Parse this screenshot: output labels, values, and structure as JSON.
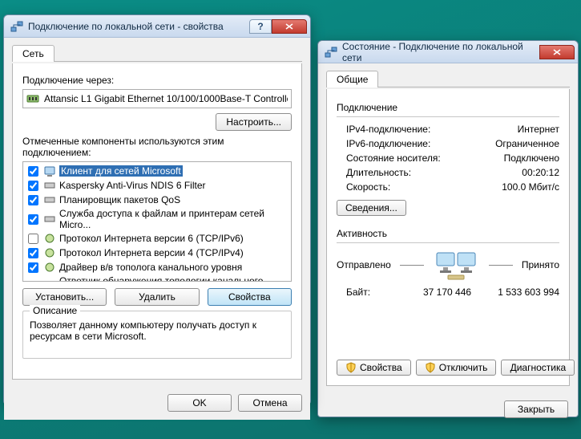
{
  "props": {
    "title": "Подключение по локальной сети - свойства",
    "tab": "Сеть",
    "connect_via": "Подключение через:",
    "adapter": "Attansic L1 Gigabit Ethernet 10/100/1000Base-T Controlle",
    "configure": "Настроить...",
    "components_label": "Отмеченные компоненты используются этим подключением:",
    "items": [
      "Клиент для сетей Microsoft",
      "Kaspersky Anti-Virus NDIS 6 Filter",
      "Планировщик пакетов QoS",
      "Служба доступа к файлам и принтерам сетей Micro...",
      "Протокол Интернета версии 6 (TCP/IPv6)",
      "Протокол Интернета версии 4 (TCP/IPv4)",
      "Драйвер в/в тополога канального уровня",
      "Ответчик обнаружения топологии канального уровня"
    ],
    "install": "Установить...",
    "remove": "Удалить",
    "properties": "Свойства",
    "desc_title": "Описание",
    "desc_text": "Позволяет данному компьютеру получать доступ к ресурсам в сети Microsoft.",
    "ok": "OK",
    "cancel": "Отмена"
  },
  "status": {
    "title": "Состояние - Подключение по локальной сети",
    "tab": "Общие",
    "sec_connection": "Подключение",
    "rows": {
      "ipv4_k": "IPv4-подключение:",
      "ipv4_v": "Интернет",
      "ipv6_k": "IPv6-подключение:",
      "ipv6_v": "Ограниченное",
      "media_k": "Состояние носителя:",
      "media_v": "Подключено",
      "dur_k": "Длительность:",
      "dur_v": "00:20:12",
      "speed_k": "Скорость:",
      "speed_v": "100.0 Мбит/с"
    },
    "details": "Сведения...",
    "sec_activity": "Активность",
    "sent": "Отправлено",
    "received": "Принято",
    "bytes_label": "Байт:",
    "bytes_sent": "37 170 446",
    "bytes_recv": "1 533 603 994",
    "btn_props": "Свойства",
    "btn_disable": "Отключить",
    "btn_diag": "Диагностика",
    "close": "Закрыть"
  }
}
